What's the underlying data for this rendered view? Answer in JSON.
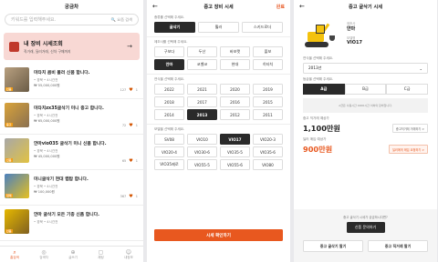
{
  "screen1": {
    "title": "궁금차",
    "search_placeholder": "키워드를 입력해주세요.",
    "search_right": "🔍 요즘 검색",
    "banner_title": "내 장비 시세조회",
    "banner_sub": "직거래, 딜러거래, 신차 구매까지",
    "items": [
      {
        "title": "미타치 콤비 볼러 신품 합니다.",
        "meta": "• 경북 • 4시간전",
        "price": "₩ 55,000,000원",
        "views": "127",
        "likes": "1",
        "tag": "신품"
      },
      {
        "title": "미타치zx35굴삭기 미니 중고 합니다.",
        "meta": "• 경북 • 4시간전",
        "price": "₩ 65,000,000원",
        "views": "72",
        "likes": "1",
        "tag": "중고"
      },
      {
        "title": "얀마vio035 굴삭기 미니 신품 합니다.",
        "meta": "• 경북 • 4시간전",
        "price": "₩ 45,000,000원",
        "views": "65",
        "likes": "1",
        "tag": "신품"
      },
      {
        "title": "미니굴삭기 현대 랩탑 합니다.",
        "meta": "• 경북 • 4시간전",
        "price": "₩ 100,000원",
        "views": "367",
        "likes": "1",
        "tag": "임대"
      },
      {
        "title": "얀마 굴삭기 모든 기종 신품 합니다.",
        "meta": "• 경북 • 4시간전",
        "price": "",
        "views": "",
        "likes": "",
        "tag": "신품"
      }
    ],
    "nav": [
      "홈검색",
      "검색차",
      "글쓰기",
      "채팅",
      "내정보"
    ]
  },
  "screen2": {
    "title": "중고 장비 시세",
    "done": "완료",
    "type_label": "종류를 선택해 주세요.",
    "types": [
      "굴삭기",
      "휠러",
      "스키드로더"
    ],
    "maker_label": "제조사를 선택해 주세요.",
    "makers": [
      "구보다",
      "두산",
      "바보캣",
      "볼보",
      "얀마",
      "코벨코",
      "현대",
      "히타치"
    ],
    "year_label": "연식을 선택해 주세요.",
    "years": [
      "2022",
      "2021",
      "2020",
      "2019",
      "2018",
      "2017",
      "2016",
      "2015",
      "2014",
      "2013",
      "2012",
      "2011"
    ],
    "model_label": "모델을 선택해 주세요.",
    "models": [
      "SV08",
      "VIO10",
      "VIO17",
      "VIO20-3",
      "VIO20-4",
      "VIO30-6",
      "VIO35-5",
      "VIO35-6",
      "VIO35제로",
      "VIO55-5",
      "VIO55-6",
      "VIO80"
    ],
    "cta": "시세 확인하기"
  },
  "screen3": {
    "title": "중고 굴삭기 시세",
    "maker_lbl": "제조사",
    "maker_val": "얀마",
    "model_lbl": "모델명",
    "model_val": "VIO17",
    "year_label": "연식을 선택해 주세요.",
    "year_val": "2013년",
    "grade_label": "등급을 선택해 주세요.",
    "grades": [
      "A급",
      "B급",
      "C급"
    ],
    "note": "A급은 사용시간 4000시간 이하의 장비입니다.",
    "trade_label": "중고 직거래 예상가",
    "trade_price": "1,100만원",
    "trade_chip": "중고직거래 거래하기 >",
    "dealer_label": "딜러 매입 예상가",
    "dealer_price": "900만원",
    "dealer_chip": "딜러에게 매입 요청하기 >",
    "bottom_text": "중고 굴삭기 시세가 궁금하시다면?",
    "bottom_dark": "신품 문의하기",
    "btn1": "중고 굴삭기 팔기",
    "btn2": "중고 직거래 팔기"
  }
}
